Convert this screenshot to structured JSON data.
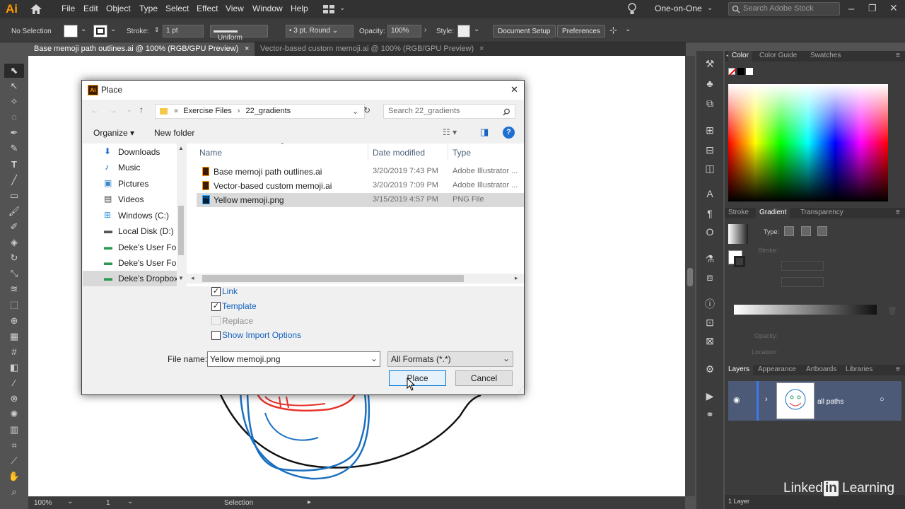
{
  "app": {
    "logo": "Ai"
  },
  "menu": [
    "File",
    "Edit",
    "Object",
    "Type",
    "Select",
    "Effect",
    "View",
    "Window",
    "Help"
  ],
  "workspace": {
    "label": "One-on-One",
    "search_placeholder": "Search Adobe Stock"
  },
  "control": {
    "selection": "No Selection",
    "stroke_label": "Stroke:",
    "stroke_value": "1 pt",
    "profile": "Uniform",
    "brush": "3 pt. Round",
    "opacity_label": "Opacity:",
    "opacity_value": "100%",
    "style_label": "Style:",
    "doc_setup": "Document Setup",
    "preferences": "Preferences"
  },
  "tabs": [
    {
      "label": "Base memoji path outlines.ai @ 100% (RGB/GPU Preview)",
      "close": "×"
    },
    {
      "label": "Vector-based custom memoji.ai @ 100% (RGB/GPU Preview)",
      "close": "×"
    }
  ],
  "status": {
    "zoom": "100%",
    "artboard": "1",
    "mode": "Selection"
  },
  "panels": {
    "color_tabs": [
      "Color",
      "Color Guide",
      "Swatches"
    ],
    "gradient_tabs": [
      "Stroke",
      "Gradient",
      "Transparency"
    ],
    "type_label": "Type:",
    "stroke_label": "Stroke:",
    "opacity_label": "Opacity:",
    "location_label": "Location:",
    "layers_tabs": [
      "Layers",
      "Appearance",
      "Artboards",
      "Libraries"
    ],
    "layer_name": "all paths",
    "layers_count": "1 Layer"
  },
  "dialog": {
    "title": "Place",
    "close": "✕",
    "path": [
      "Exercise Files",
      "22_gradients"
    ],
    "search_placeholder": "Search 22_gradients",
    "organize": "Organize",
    "new_folder": "New folder",
    "nav_items": [
      "Downloads",
      "Music",
      "Pictures",
      "Videos",
      "Windows (C:)",
      "Local Disk (D:)",
      "Deke's User Fold",
      "Deke's User Fold",
      "Deke's Dropbox"
    ],
    "columns": [
      "Name",
      "Date modified",
      "Type"
    ],
    "files": [
      {
        "name": "Base memoji path outlines.ai",
        "date": "3/20/2019 7:43 PM",
        "type": "Adobe Illustrator ..."
      },
      {
        "name": "Vector-based custom memoji.ai",
        "date": "3/20/2019 7:09 PM",
        "type": "Adobe Illustrator ..."
      },
      {
        "name": "Yellow memoji.png",
        "date": "3/15/2019 4:57 PM",
        "type": "PNG File"
      }
    ],
    "options": {
      "link": "Link",
      "template": "Template",
      "replace": "Replace",
      "show_import": "Show Import Options"
    },
    "file_name_label": "File name:",
    "file_name_value": "Yellow memoji.png",
    "formats": "All Formats (*.*)",
    "place_button": "Place",
    "cancel_button": "Cancel"
  },
  "brand": {
    "prefix": "Linked",
    "in": "in",
    "suffix": " Learning"
  },
  "colors": {
    "accent": "#1563c0",
    "illustrator": "#ff9a00",
    "selected_row": "#cce8ff",
    "layer_highlight": "#4c5a78"
  }
}
